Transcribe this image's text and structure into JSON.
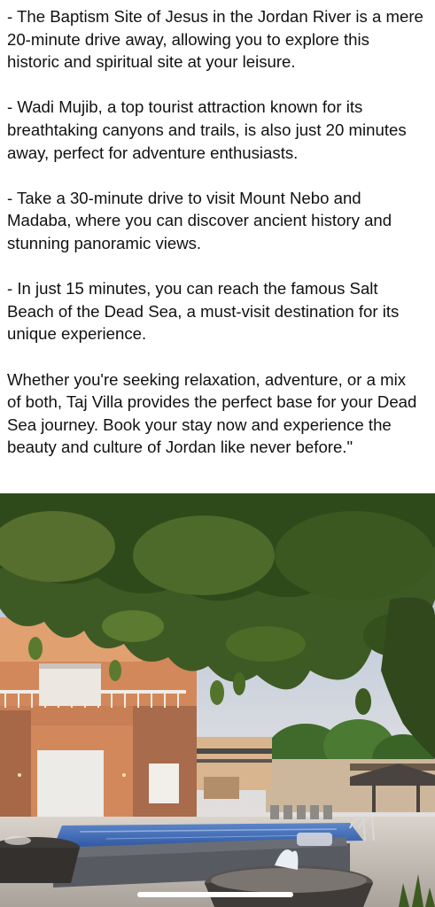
{
  "post": {
    "paragraphs": [
      "- The Baptism Site of Jesus in the Jordan River is a mere 20-minute drive away, allowing you to explore this historic and spiritual site at your leisure.",
      "- Wadi Mujib, a top tourist attraction known for its breathtaking canyons and trails, is also just 20 minutes away, perfect for adventure enthusiasts.",
      "- Take a 30-minute drive to visit Mount Nebo and Madaba, where you can discover ancient history and stunning panoramic views.",
      "- In just 15 minutes, you can reach the famous Salt Beach of the Dead Sea, a must-visit destination for its unique experience.",
      "Whether you're seeking relaxation, adventure, or a mix of both, Taj Villa provides the perfect base for your Dead Sea journey. Book your stay now and experience the beauty and culture of Jordan like never before.\""
    ]
  },
  "photo": {
    "subject": "villa-pool-courtyard-photo"
  },
  "colors": {
    "text": "#111111",
    "background": "#ffffff"
  }
}
